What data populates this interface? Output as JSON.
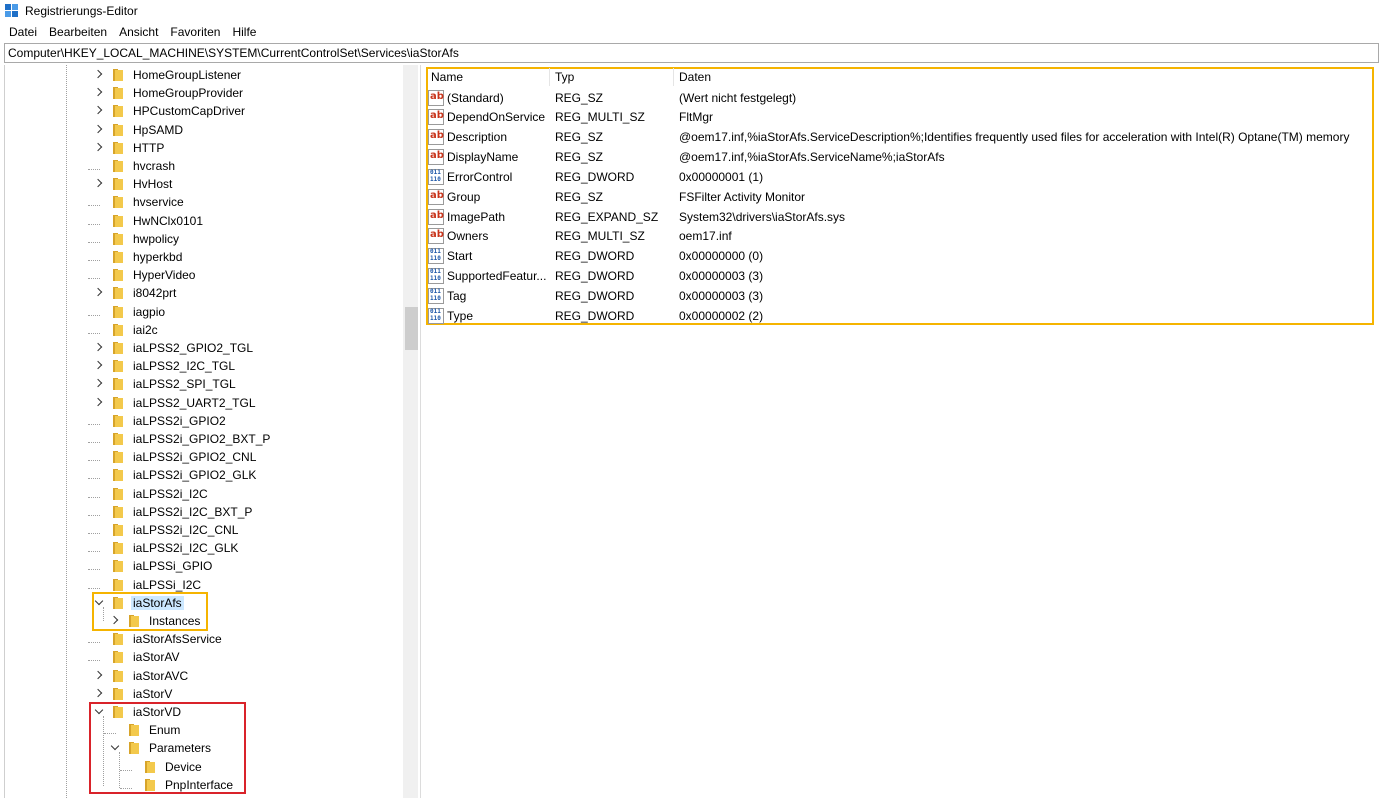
{
  "window": {
    "title": "Registrierungs-Editor",
    "icon": "registry-editor-icon"
  },
  "menu": [
    "Datei",
    "Bearbeiten",
    "Ansicht",
    "Favoriten",
    "Hilfe"
  ],
  "address": "Computer\\HKEY_LOCAL_MACHINE\\SYSTEM\\CurrentControlSet\\Services\\iaStorAfs",
  "tree": {
    "items": [
      {
        "label": "HomeGroupListener",
        "level": 0,
        "expander": "right"
      },
      {
        "label": "HomeGroupProvider",
        "level": 0,
        "expander": "right"
      },
      {
        "label": "HPCustomCapDriver",
        "level": 0,
        "expander": "right"
      },
      {
        "label": "HpSAMD",
        "level": 0,
        "expander": "right"
      },
      {
        "label": "HTTP",
        "level": 0,
        "expander": "right"
      },
      {
        "label": "hvcrash",
        "level": 0,
        "expander": "none"
      },
      {
        "label": "HvHost",
        "level": 0,
        "expander": "right"
      },
      {
        "label": "hvservice",
        "level": 0,
        "expander": "none"
      },
      {
        "label": "HwNClx0101",
        "level": 0,
        "expander": "none"
      },
      {
        "label": "hwpolicy",
        "level": 0,
        "expander": "none"
      },
      {
        "label": "hyperkbd",
        "level": 0,
        "expander": "none"
      },
      {
        "label": "HyperVideo",
        "level": 0,
        "expander": "none"
      },
      {
        "label": "i8042prt",
        "level": 0,
        "expander": "right"
      },
      {
        "label": "iagpio",
        "level": 0,
        "expander": "none"
      },
      {
        "label": "iai2c",
        "level": 0,
        "expander": "none"
      },
      {
        "label": "iaLPSS2_GPIO2_TGL",
        "level": 0,
        "expander": "right"
      },
      {
        "label": "iaLPSS2_I2C_TGL",
        "level": 0,
        "expander": "right"
      },
      {
        "label": "iaLPSS2_SPI_TGL",
        "level": 0,
        "expander": "right"
      },
      {
        "label": "iaLPSS2_UART2_TGL",
        "level": 0,
        "expander": "right"
      },
      {
        "label": "iaLPSS2i_GPIO2",
        "level": 0,
        "expander": "none"
      },
      {
        "label": "iaLPSS2i_GPIO2_BXT_P",
        "level": 0,
        "expander": "none"
      },
      {
        "label": "iaLPSS2i_GPIO2_CNL",
        "level": 0,
        "expander": "none"
      },
      {
        "label": "iaLPSS2i_GPIO2_GLK",
        "level": 0,
        "expander": "none"
      },
      {
        "label": "iaLPSS2i_I2C",
        "level": 0,
        "expander": "none"
      },
      {
        "label": "iaLPSS2i_I2C_BXT_P",
        "level": 0,
        "expander": "none"
      },
      {
        "label": "iaLPSS2i_I2C_CNL",
        "level": 0,
        "expander": "none"
      },
      {
        "label": "iaLPSS2i_I2C_GLK",
        "level": 0,
        "expander": "none"
      },
      {
        "label": "iaLPSSi_GPIO",
        "level": 0,
        "expander": "none"
      },
      {
        "label": "iaLPSSi_I2C",
        "level": 0,
        "expander": "none"
      },
      {
        "label": "iaStorAfs",
        "level": 0,
        "expander": "down",
        "selected": true
      },
      {
        "label": "Instances",
        "level": 1,
        "expander": "right"
      },
      {
        "label": "iaStorAfsService",
        "level": 0,
        "expander": "none"
      },
      {
        "label": "iaStorAV",
        "level": 0,
        "expander": "none"
      },
      {
        "label": "iaStorAVC",
        "level": 0,
        "expander": "right"
      },
      {
        "label": "iaStorV",
        "level": 0,
        "expander": "right"
      },
      {
        "label": "iaStorVD",
        "level": 0,
        "expander": "down"
      },
      {
        "label": "Enum",
        "level": 1,
        "expander": "none"
      },
      {
        "label": "Parameters",
        "level": 1,
        "expander": "down"
      },
      {
        "label": "Device",
        "level": 2,
        "expander": "none"
      },
      {
        "label": "PnpInterface",
        "level": 2,
        "expander": "none"
      }
    ]
  },
  "list": {
    "columns": [
      "Name",
      "Typ",
      "Daten"
    ],
    "rows": [
      {
        "icon": "string-value-icon",
        "kind": "sz",
        "name": "(Standard)",
        "type": "REG_SZ",
        "data": "(Wert nicht festgelegt)"
      },
      {
        "icon": "string-value-icon",
        "kind": "sz",
        "name": "DependOnService",
        "type": "REG_MULTI_SZ",
        "data": "FltMgr"
      },
      {
        "icon": "string-value-icon",
        "kind": "sz",
        "name": "Description",
        "type": "REG_SZ",
        "data": "@oem17.inf,%iaStorAfs.ServiceDescription%;Identifies frequently used files for acceleration with Intel(R) Optane(TM) memory"
      },
      {
        "icon": "string-value-icon",
        "kind": "sz",
        "name": "DisplayName",
        "type": "REG_SZ",
        "data": "@oem17.inf,%iaStorAfs.ServiceName%;iaStorAfs"
      },
      {
        "icon": "binary-value-icon",
        "kind": "dw",
        "name": "ErrorControl",
        "type": "REG_DWORD",
        "data": "0x00000001 (1)"
      },
      {
        "icon": "string-value-icon",
        "kind": "sz",
        "name": "Group",
        "type": "REG_SZ",
        "data": "FSFilter Activity Monitor"
      },
      {
        "icon": "string-value-icon",
        "kind": "sz",
        "name": "ImagePath",
        "type": "REG_EXPAND_SZ",
        "data": "System32\\drivers\\iaStorAfs.sys"
      },
      {
        "icon": "string-value-icon",
        "kind": "sz",
        "name": "Owners",
        "type": "REG_MULTI_SZ",
        "data": "oem17.inf"
      },
      {
        "icon": "binary-value-icon",
        "kind": "dw",
        "name": "Start",
        "type": "REG_DWORD",
        "data": "0x00000000 (0)"
      },
      {
        "icon": "binary-value-icon",
        "kind": "dw",
        "name": "SupportedFeatur...",
        "type": "REG_DWORD",
        "data": "0x00000003 (3)"
      },
      {
        "icon": "binary-value-icon",
        "kind": "dw",
        "name": "Tag",
        "type": "REG_DWORD",
        "data": "0x00000003 (3)"
      },
      {
        "icon": "binary-value-icon",
        "kind": "dw",
        "name": "Type",
        "type": "REG_DWORD",
        "data": "0x00000002 (2)"
      }
    ]
  },
  "colors": {
    "selection": "#cce8ff",
    "highlight_yellow": "#f5b400",
    "highlight_red": "#d9232a",
    "folder": "#f3c94c"
  }
}
